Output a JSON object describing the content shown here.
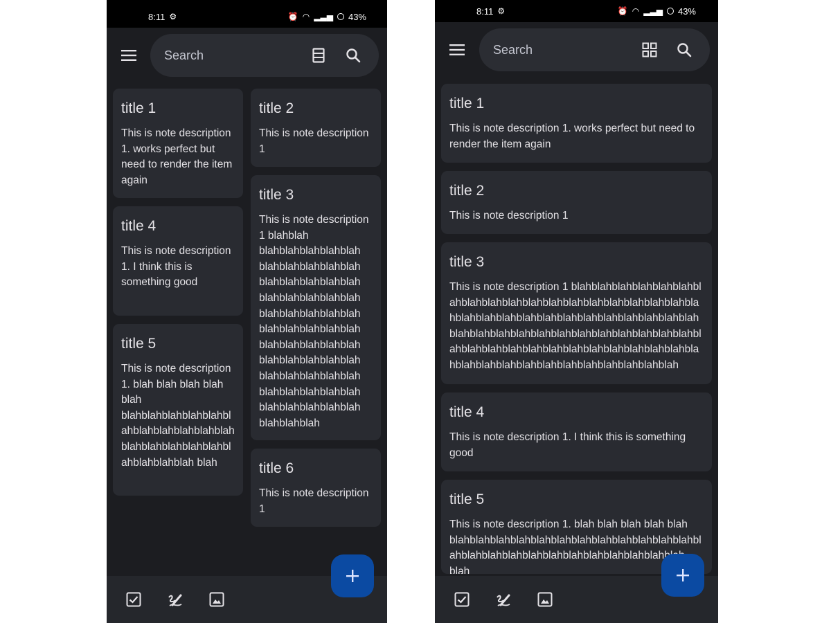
{
  "left_screen": {
    "status": {
      "time": "8:11",
      "battery": "43%"
    },
    "search": {
      "placeholder": "Search"
    },
    "view_toggle_icon": "list-view-icon",
    "notes": [
      {
        "title": "title 1",
        "description": "This is note description 1. works perfect but need to render the item again"
      },
      {
        "title": "title 2",
        "description": "This is note description 1"
      },
      {
        "title": "title 3",
        "description": "This is note description 1 blahblah blahblahblahblahblah blahblahblahblahblah blahblahblahblahblah blahblahblahblahblah blahblahblahblahblah blahblahblahblahblah blahblahblahblahblah blahblahblahblahblah blahblahblahblahblah blahblahblahblahblah blahblahblahblahblah blahblahblah"
      },
      {
        "title": "title 4",
        "description": "This is note description 1. I think this is something good"
      },
      {
        "title": "title 5",
        "description": "This is note description 1. blah blah blah blah blah blahblahblahblahblahblahblahblahblahblahblahblahblahblahblahblahblahblahblahblah blah"
      },
      {
        "title": "title 6",
        "description": "This is note description 1"
      }
    ]
  },
  "right_screen": {
    "status": {
      "time": "8:11",
      "battery": "43%"
    },
    "search": {
      "placeholder": "Search"
    },
    "view_toggle_icon": "grid-view-icon",
    "notes": [
      {
        "title": "title 1",
        "description": "This is note description 1. works perfect but need to render the item again"
      },
      {
        "title": "title 2",
        "description": "This is note description 1"
      },
      {
        "title": "title 3",
        "description": "This is note description 1 blahblahblahblahblahblahblahblahblahblahblahblahblahblahblahblahblahblahblahblahblahblahblahblahblahblahblahblahblahblahblahblahblahblahblahblahblahblahblahblahblahblahblahblahblahblahblahblahblahblahblahblahblahblahblahblahblahblahblahblahblahblahblahblahblahblahblah"
      },
      {
        "title": "title 4",
        "description": "This is note description 1. I think this is something good"
      },
      {
        "title": "title 5",
        "description": "This is note description 1. blah blah blah blah blah blahblahblahblahblahblahblahblahblahblahblahblahblahblahblahblahblahblahblahblahblahblahblahblah blah"
      }
    ]
  },
  "bottom_bar": {
    "icons": [
      "checkbox-icon",
      "draw-icon",
      "image-icon"
    ]
  },
  "fab": {
    "icon": "add-icon"
  },
  "colors": {
    "background": "#1c1d21",
    "card": "#292b31",
    "fab": "#0b4aa2",
    "text": "#e4e2e6"
  }
}
